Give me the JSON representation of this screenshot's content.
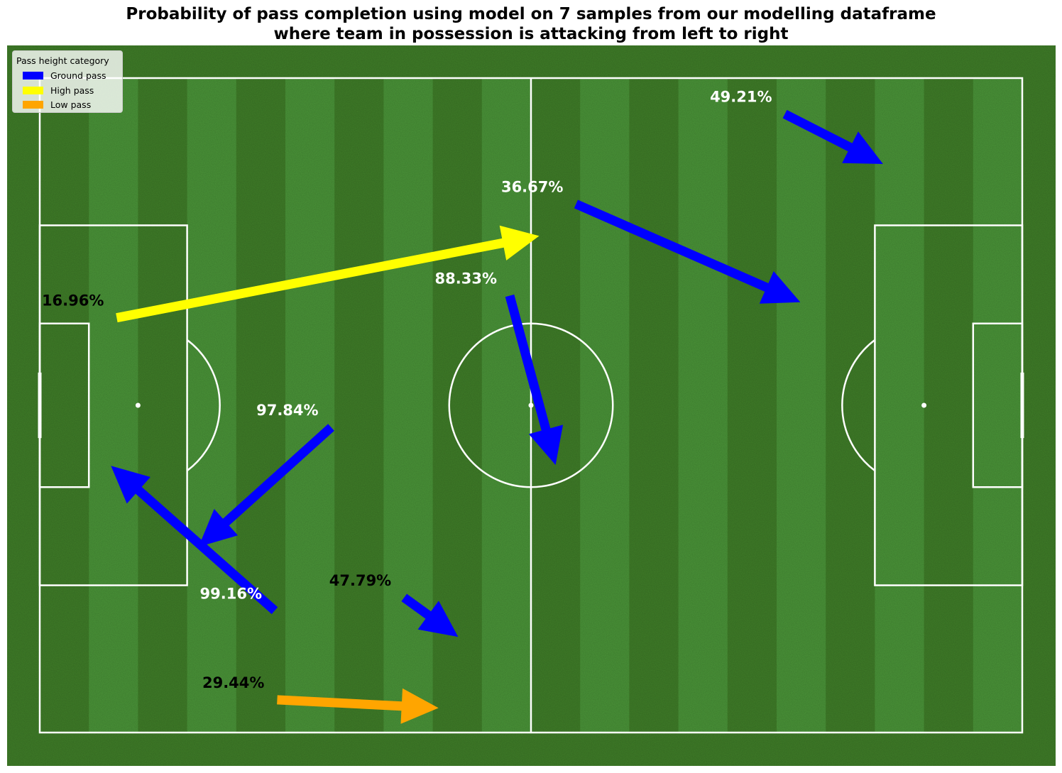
{
  "title_line1": "Probability of pass completion using model on 7 samples from our modelling dataframe",
  "title_line2": "where team in possession is attacking from left to right",
  "legend": {
    "title": "Pass height category",
    "items": [
      {
        "label": "Ground pass",
        "color": "#0000ff"
      },
      {
        "label": "High pass",
        "color": "#ffff00"
      },
      {
        "label": "Low pass",
        "color": "#ffa500"
      }
    ]
  },
  "colors": {
    "ground_pass": "#0000ff",
    "high_pass": "#ffff00",
    "low_pass": "#ffa500",
    "grass_dark": "#3f7d28",
    "grass_light": "#4a9438",
    "lines": "#ffffff"
  },
  "chart_data": {
    "type": "scatter",
    "pitch": {
      "length": 120,
      "width": 80,
      "attacking_direction": "left to right"
    },
    "passes": [
      {
        "label": "16.96%",
        "probability": 16.96,
        "height": "High pass",
        "start": [
          9.4,
          29.3
        ],
        "end": [
          61.0,
          19.3
        ],
        "label_color": "#000000"
      },
      {
        "label": "36.67%",
        "probability": 36.67,
        "height": "Ground pass",
        "start": [
          65.5,
          15.4
        ],
        "end": [
          92.9,
          27.4
        ],
        "label_color": "#ffffff"
      },
      {
        "label": "49.21%",
        "probability": 49.21,
        "height": "Ground pass",
        "start": [
          91.0,
          4.4
        ],
        "end": [
          103.0,
          10.5
        ],
        "label_color": "#ffffff"
      },
      {
        "label": "88.33%",
        "probability": 88.33,
        "height": "Ground pass",
        "start": [
          57.4,
          26.6
        ],
        "end": [
          63.0,
          47.3
        ],
        "label_color": "#ffffff"
      },
      {
        "label": "97.84%",
        "probability": 97.84,
        "height": "Ground pass",
        "start": [
          35.6,
          42.7
        ],
        "end": [
          19.4,
          57.3
        ],
        "label_color": "#ffffff"
      },
      {
        "label": "99.16%",
        "probability": 99.16,
        "height": "Ground pass",
        "start": [
          28.7,
          65.1
        ],
        "end": [
          8.7,
          47.4
        ],
        "label_color": "#ffffff"
      },
      {
        "label": "47.79%",
        "probability": 47.79,
        "height": "Ground pass",
        "start": [
          44.5,
          63.5
        ],
        "end": [
          51.1,
          68.3
        ],
        "label_color": "#000000"
      },
      {
        "label": "29.44%",
        "probability": 29.44,
        "height": "Low pass",
        "start": [
          29.0,
          76.0
        ],
        "end": [
          48.7,
          77.0
        ],
        "label_color": "#000000"
      }
    ]
  }
}
